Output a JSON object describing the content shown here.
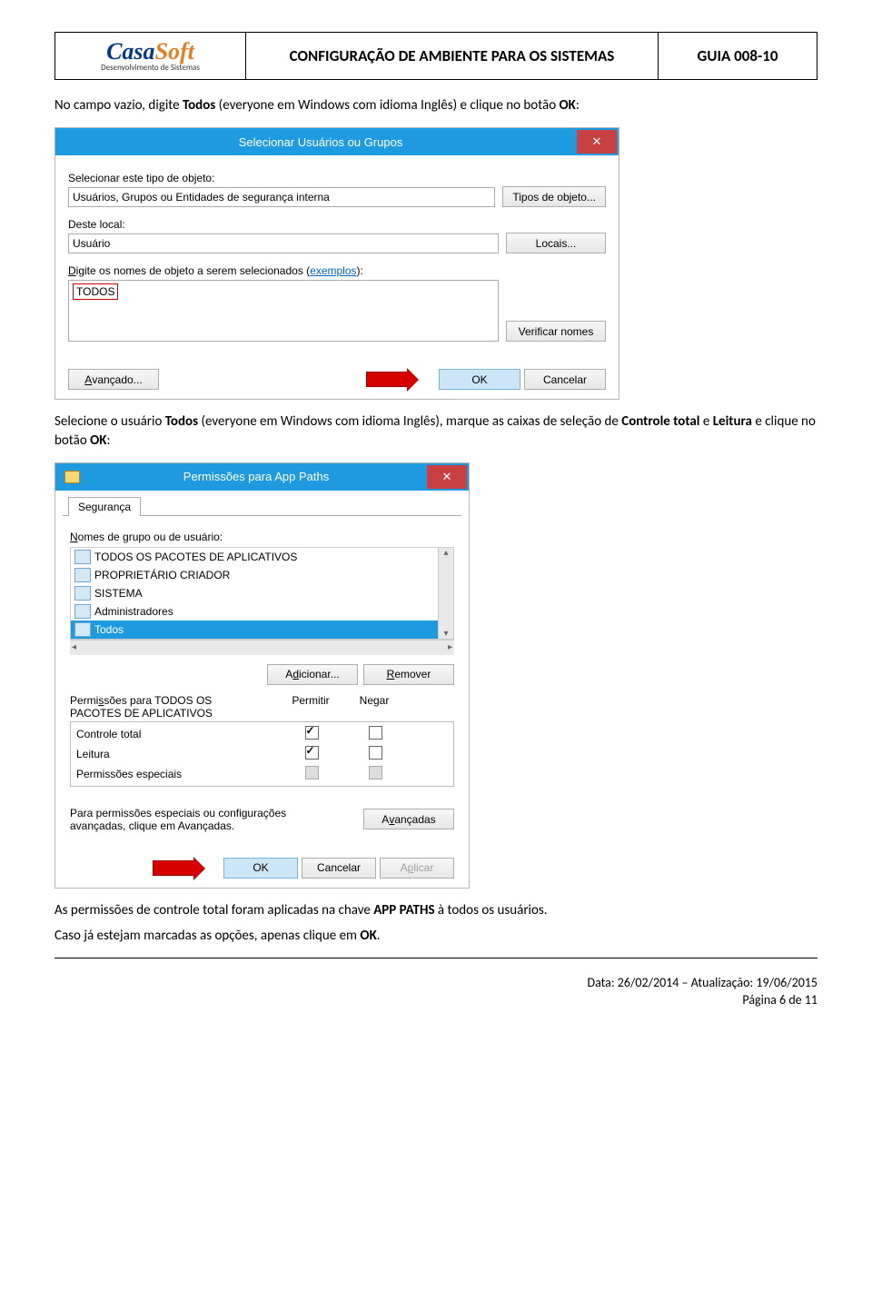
{
  "header": {
    "title": "CONFIGURAÇÃO DE AMBIENTE PARA OS SISTEMAS",
    "code": "GUIA 008-10",
    "logo": {
      "a": "Casa",
      "b": "Soft",
      "sub": "Desenvolvimento de Sistemas"
    }
  },
  "p1": {
    "pre": "No campo vazio, digite ",
    "b1": "Todos",
    "mid": " (everyone em Windows com idioma Inglês) e clique no botão ",
    "b2": "OK",
    "post": ":"
  },
  "win1": {
    "title": "Selecionar Usuários ou Grupos",
    "lbl_obj": "Selecionar este tipo de objeto:",
    "val_obj": "Usuários, Grupos ou Entidades de segurança interna",
    "btn_obj": "Tipos de objeto...",
    "lbl_loc": "Deste local:",
    "val_loc": "Usuário",
    "btn_loc": "Locais...",
    "lbl_names_pre": "Digite os nomes de objeto a serem selecionados (",
    "lbl_names_link": "exemplos",
    "lbl_names_post": "):",
    "val_names": "TODOS",
    "btn_ver": "Verificar nomes",
    "btn_adv": "Avançado...",
    "btn_ok": "OK",
    "btn_cancel": "Cancelar"
  },
  "p2": {
    "pre": "Selecione o usuário ",
    "b1": "Todos",
    "mid1": " (everyone em Windows com idioma Inglês), marque as caixas de seleção de ",
    "b2": "Controle total",
    "mid2": " e ",
    "b3": "Leitura",
    "mid3": " e clique no botão ",
    "b4": "OK",
    "post": ":"
  },
  "win2": {
    "title": "Permissões para App Paths",
    "tab": "Segurança",
    "lbl_groups": "Nomes de grupo ou de usuário:",
    "groups": [
      "TODOS OS PACOTES DE APLICATIVOS",
      "PROPRIETÁRIO CRIADOR",
      "SISTEMA",
      "Administradores",
      "Todos"
    ],
    "btn_add": "Adicionar...",
    "btn_rem": "Remover",
    "lbl_perm_for": "Permissões para TODOS OS\nPACOTES DE APLICATIVOS",
    "col_allow": "Permitir",
    "col_deny": "Negar",
    "perms": [
      {
        "n": "Controle total",
        "a": true,
        "d": false,
        "sg": false
      },
      {
        "n": "Leitura",
        "a": true,
        "d": false,
        "sg": false
      },
      {
        "n": "Permissões especiais",
        "a": false,
        "d": false,
        "sg": true
      }
    ],
    "adv_txt": "Para permissões especiais ou configurações avançadas, clique em Avançadas.",
    "btn_adv": "Avançadas",
    "btn_ok": "OK",
    "btn_cancel": "Cancelar",
    "btn_apply": "Aplicar"
  },
  "p3": {
    "pre": "As permissões de controle total foram aplicadas na chave ",
    "b1": "APP PATHS",
    "post": " à todos os usuários."
  },
  "p4": {
    "pre": "Caso já estejam marcadas as opções, apenas clique em ",
    "b1": "OK",
    "post": "."
  },
  "footer": {
    "l1": "Data: 26/02/2014 – Atualização: 19/06/2015",
    "l2": "Página 6 de 11"
  }
}
